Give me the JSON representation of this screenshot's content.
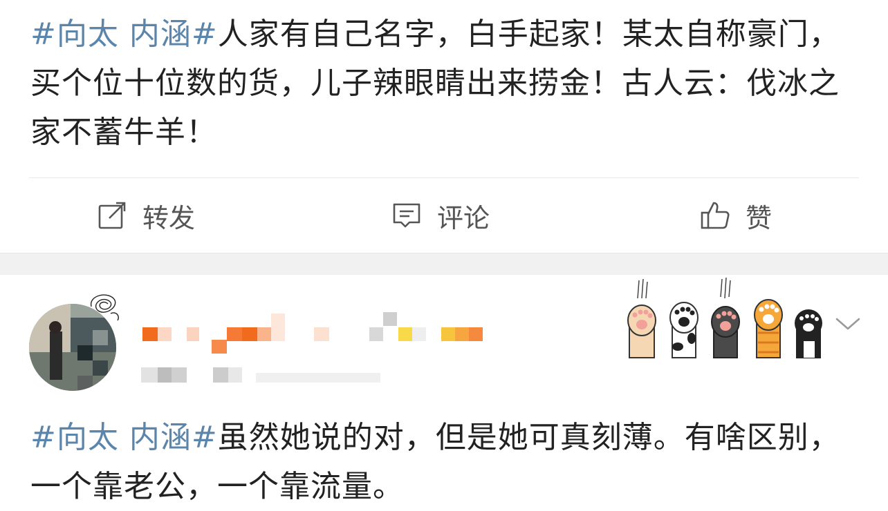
{
  "post1": {
    "hashtag": "#向太 内涵#",
    "text": "人家有自己名字，白手起家！某太自称豪门，买个位十位数的货，儿子辣眼睛出来捞金！古人云：伐冰之家不蓄牛羊！"
  },
  "actions": {
    "repost_label": "转发",
    "comment_label": "评论",
    "like_label": "赞"
  },
  "post2": {
    "hashtag": "#向太 内涵#",
    "text": "虽然她说的对，但是她可真刻薄。有啥区别，一个靠老公，一个靠流量。"
  },
  "colors": {
    "hashtag": "#5b85aa",
    "text": "#222222",
    "action_text": "#555555",
    "separator_band": "#f1f1f1"
  },
  "icons": [
    "repost-icon",
    "comment-icon",
    "like-icon",
    "chevron-down-icon",
    "cat-paw-stickers"
  ]
}
